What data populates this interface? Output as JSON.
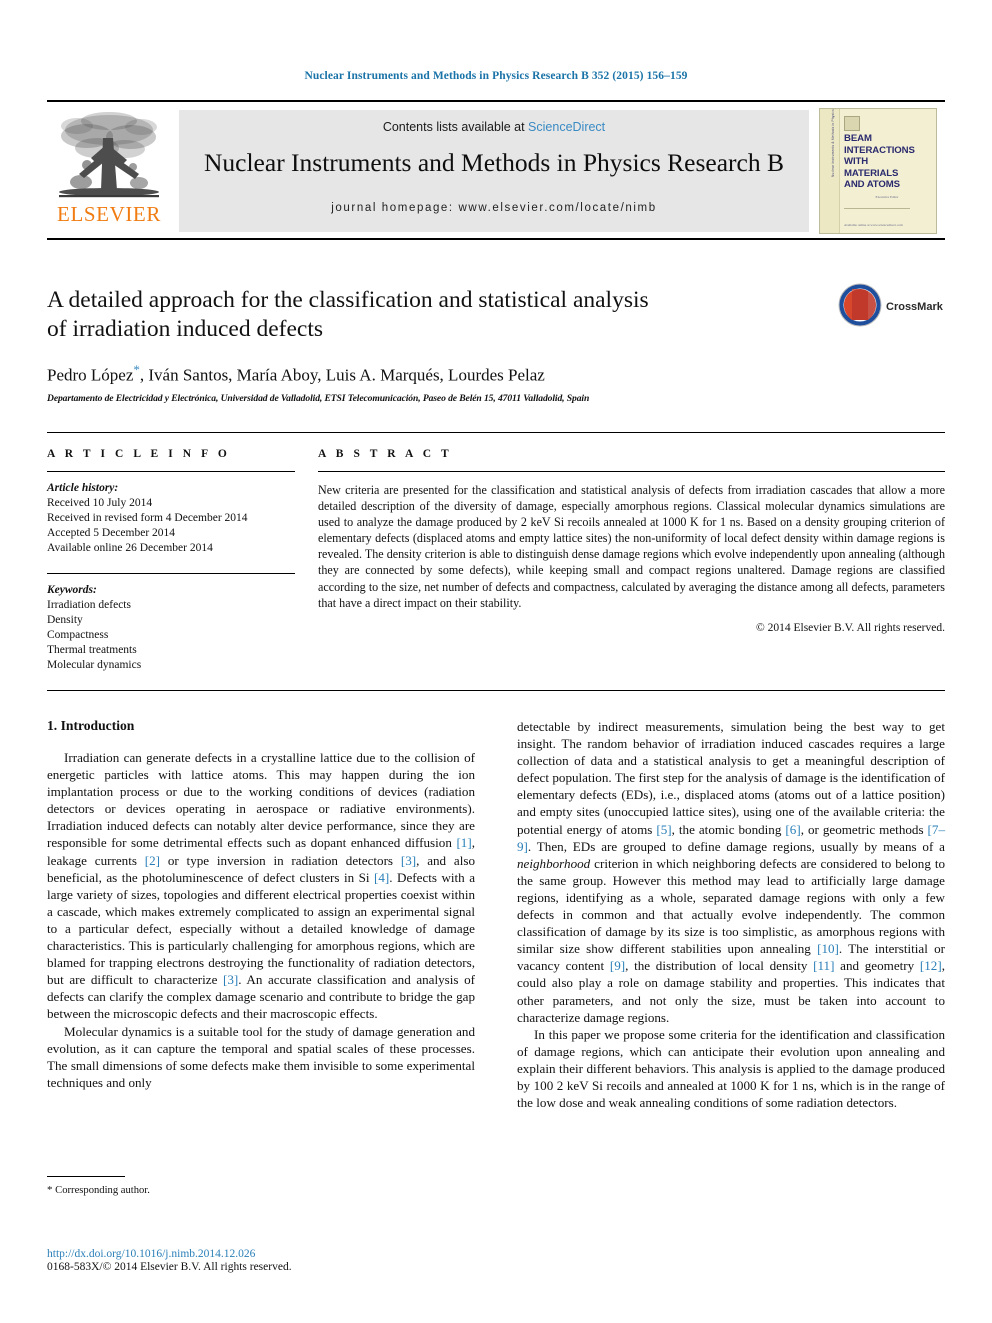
{
  "running_head": "Nuclear Instruments and Methods in Physics Research B 352 (2015) 156–159",
  "masthead": {
    "publisher": "ELSEVIER",
    "contents_prefix": "Contents lists available at ",
    "sciencedirect": "ScienceDirect",
    "journal_title": "Nuclear Instruments and Methods in Physics Research B",
    "homepage": "journal homepage: www.elsevier.com/locate/nimb",
    "cover": {
      "title_line1": "BEAM",
      "title_line2": "INTERACTIONS",
      "title_line3": "WITH",
      "title_line4": "MATERIALS",
      "title_line5": "AND ATOMS",
      "spine_text": "Nuclear Instruments & Methods in Physics Research B",
      "mid_text": "Executive Editor",
      "foot_text": "Available online at www.sciencedirect.com"
    }
  },
  "article": {
    "title_line1": "A detailed approach for the classification and statistical analysis",
    "title_line2": "of irradiation induced defects",
    "authors": "Pedro López",
    "authors_rest": ", Iván Santos, María Aboy, Luis A. Marqués, Lourdes Pelaz",
    "corresponding_star": "*",
    "affiliation": "Departamento de Electricidad y Electrónica, Universidad de Valladolid, ETSI Telecomunicación, Paseo de Belén 15, 47011 Valladolid, Spain",
    "crossmark_label": "CrossMark"
  },
  "article_info": {
    "heading": "A R T I C L E    I N F O",
    "history_label": "Article history:",
    "history": [
      "Received 10 July 2014",
      "Received in revised form 4 December 2014",
      "Accepted 5 December 2014",
      "Available online 26 December 2014"
    ],
    "keywords_label": "Keywords:",
    "keywords": [
      "Irradiation defects",
      "Density",
      "Compactness",
      "Thermal treatments",
      "Molecular dynamics"
    ]
  },
  "abstract": {
    "heading": "A B S T R A C T",
    "text": "New criteria are presented for the classification and statistical analysis of defects from irradiation cascades that allow a more detailed description of the diversity of damage, especially amorphous regions. Classical molecular dynamics simulations are used to analyze the damage produced by 2 keV Si recoils annealed at 1000 K for 1 ns. Based on a density grouping criterion of elementary defects (displaced atoms and empty lattice sites) the non-uniformity of local defect density within damage regions is revealed. The density criterion is able to distinguish dense damage regions which evolve independently upon annealing (although they are connected by some defects), while keeping small and compact regions unaltered. Damage regions are classified according to the size, net number of defects and compactness, calculated by averaging the distance among all defects, parameters that have a direct impact on their stability.",
    "copyright": "© 2014 Elsevier B.V. All rights reserved."
  },
  "introduction": {
    "heading": "1. Introduction",
    "left_p1_a": "Irradiation can generate defects in a crystalline lattice due to the collision of energetic particles with lattice atoms. This may happen during the ion implantation process or due to the working conditions of devices (radiation detectors or devices operating in aerospace or radiative environments). Irradiation induced defects can notably alter device performance, since they are responsible for some detrimental effects such as dopant enhanced diffusion ",
    "ref1": "[1]",
    "left_p1_b": ", leakage currents ",
    "ref2": "[2]",
    "left_p1_c": " or type inversion in radiation detectors ",
    "ref3": "[3]",
    "left_p1_d": ", and also beneficial, as the photoluminescence of defect clusters in Si ",
    "ref4": "[4]",
    "left_p1_e": ". Defects with a large variety of sizes, topologies and different electrical properties coexist within a cascade, which makes extremely complicated to assign an experimental signal to a particular defect, especially without a detailed knowledge of damage characteristics. This is particularly challenging for amorphous regions, which are blamed for trapping electrons destroying the functionality of radiation detectors, but are difficult to characterize ",
    "ref3b": "[3]",
    "left_p1_f": ". An accurate classification and analysis of defects can clarify the complex damage scenario and contribute to bridge the gap between the microscopic defects and their macroscopic effects.",
    "left_p2": "Molecular dynamics is a suitable tool for the study of damage generation and evolution, as it can capture the temporal and spatial scales of these processes. The small dimensions of some defects make them invisible to some experimental techniques and only",
    "right_p1_a": "detectable by indirect measurements, simulation being the best way to get insight. The random behavior of irradiation induced cascades requires a large collection of data and a statistical analysis to get a meaningful description of defect population. The first step for the analysis of damage is the identification of elementary defects (EDs), i.e., displaced atoms (atoms out of a lattice position) and empty sites (unoccupied lattice sites), using one of the available criteria: the potential energy of atoms ",
    "ref5": "[5]",
    "right_p1_b": ", the atomic bonding ",
    "ref6": "[6]",
    "right_p1_c": ", or geometric methods ",
    "ref79": "[7–9]",
    "right_p1_d": ". Then, EDs are grouped to define damage regions, usually by means of a ",
    "neighborhood": "neighborhood",
    "right_p1_e": " criterion in which neighboring defects are considered to belong to the same group. However this method may lead to artificially large damage regions, identifying as a whole, separated damage regions with only a few defects in common and that actually evolve independently. The common classification of damage by its size is too simplistic, as amorphous regions with similar size show different stabilities upon annealing ",
    "ref10": "[10]",
    "right_p1_f": ". The interstitial or vacancy content ",
    "ref9": "[9]",
    "right_p1_g": ", the distribution of local density ",
    "ref11": "[11]",
    "right_p1_h": " and geometry ",
    "ref12": "[12]",
    "right_p1_i": ", could also play a role on damage stability and properties. This indicates that other parameters, and not only the size, must be taken into account to characterize damage regions.",
    "right_p2": "In this paper we propose some criteria for the identification and classification of damage regions, which can anticipate their evolution upon annealing and explain their different behaviors. This analysis is applied to the damage produced by 100 2 keV Si recoils and annealed at 1000 K for 1 ns, which is in the range of the low dose and weak annealing conditions of some radiation detectors."
  },
  "footnote": {
    "star": "*",
    "text": " Corresponding author."
  },
  "bottom": {
    "doi": "http://dx.doi.org/10.1016/j.nimb.2014.12.026",
    "issn": "0168-583X/© 2014 Elsevier B.V. All rights reserved."
  },
  "colors": {
    "link": "#2a7fb8",
    "elsevier_orange": "#f07c12",
    "band": "#e6e6e6"
  }
}
